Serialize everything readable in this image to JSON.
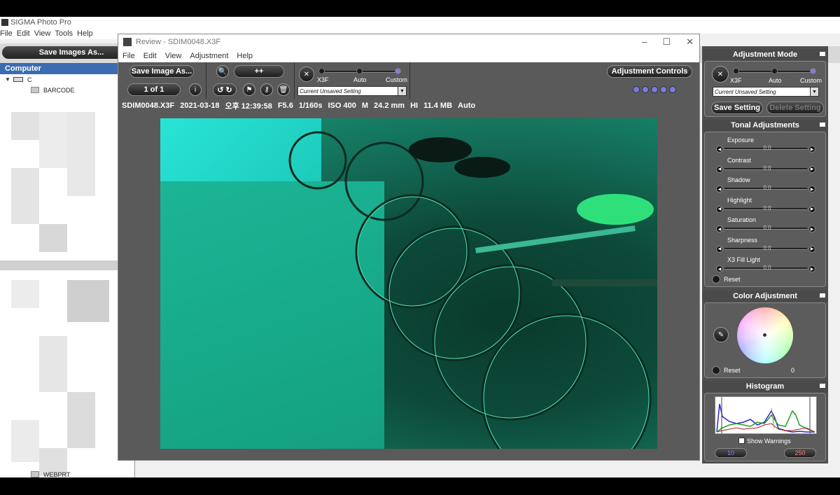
{
  "app": {
    "title": "SIGMA Photo Pro",
    "menu": [
      "File",
      "Edit",
      "View",
      "Tools",
      "Help"
    ],
    "save_images_label": "Save Images As..."
  },
  "computer": {
    "header": "Computer",
    "drive": "C",
    "folder_top": "BARCODE",
    "folder_bottom": "WEBPRT"
  },
  "review": {
    "title": "Review - SDIM0048.X3F",
    "menu": [
      "File",
      "Edit",
      "View",
      "Adjustment",
      "Help"
    ],
    "save_image_label": "Save Image As...",
    "zoom_label": "++",
    "page_label": "1 of 1",
    "adjustment_controls_label": "Adjustment Controls",
    "modes": [
      "X3F",
      "Auto",
      "Custom"
    ],
    "setting_dropdown": "Current Unsaved Setting",
    "info": {
      "filename": "SDIM0048.X3F",
      "date": "2021-03-18",
      "time": "오후 12:39:58",
      "aperture": "F5.6",
      "shutter": "1/160s",
      "iso": "ISO 400",
      "mode": "M",
      "focal": "24.2 mm",
      "quality": "HI",
      "size": "11.4 MB",
      "wb": "Auto"
    }
  },
  "adjustment_mode": {
    "header": "Adjustment Mode",
    "modes": [
      "X3F",
      "Auto",
      "Custom"
    ],
    "setting_dropdown": "Current Unsaved Setting",
    "save_setting": "Save Setting",
    "delete_setting": "Delete Setting"
  },
  "tonal": {
    "header": "Tonal Adjustments",
    "items": [
      {
        "label": "Exposure",
        "value": "0.0"
      },
      {
        "label": "Contrast",
        "value": "0.0"
      },
      {
        "label": "Shadow",
        "value": "0.0"
      },
      {
        "label": "Highlight",
        "value": "0.0"
      },
      {
        "label": "Saturation",
        "value": "0.0"
      },
      {
        "label": "Sharpness",
        "value": "0.0"
      },
      {
        "label": "X3 Fill Light",
        "value": "0.0"
      }
    ],
    "reset": "Reset"
  },
  "color": {
    "header": "Color Adjustment",
    "reset": "Reset",
    "value": "0"
  },
  "histogram": {
    "header": "Histogram",
    "show_warnings": "Show Warnings",
    "low": "10",
    "high": "250"
  }
}
